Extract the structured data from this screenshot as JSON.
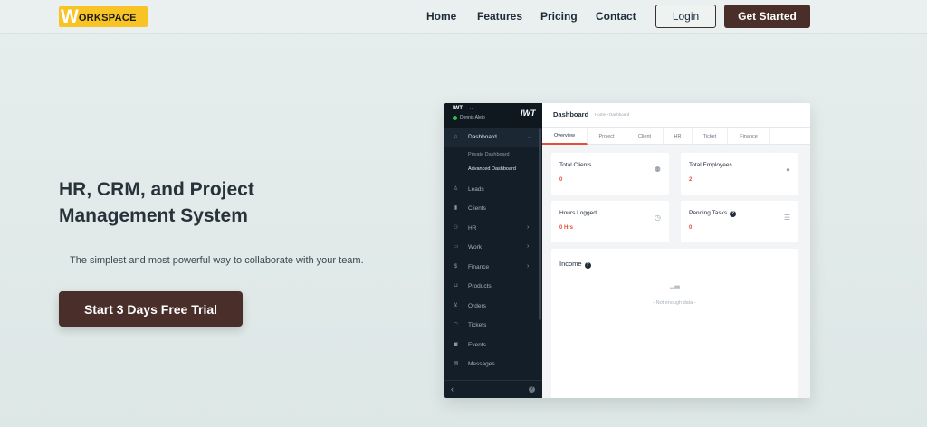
{
  "nav": {
    "logo_w": "W",
    "logo_rest": "ORKSPACE",
    "links": [
      "Home",
      "Features",
      "Pricing",
      "Contact"
    ],
    "login_label": "Login",
    "get_started_label": "Get Started"
  },
  "hero": {
    "title": "HR, CRM, and Project Management System",
    "subtitle": "The simplest and most powerful way to collaborate with your team.",
    "cta_label": "Start 3 Days Free Trial"
  },
  "dashboard": {
    "sidebar": {
      "org": "IWT",
      "user": "Dennis Alejo",
      "logo": "IWT",
      "items": [
        {
          "label": "Dashboard",
          "icon": "home-icon",
          "chevron": "down"
        },
        {
          "label": "Leads",
          "icon": "user-icon",
          "chevron": ""
        },
        {
          "label": "Clients",
          "icon": "bar-chart-icon",
          "chevron": ""
        },
        {
          "label": "HR",
          "icon": "people-icon",
          "chevron": "right"
        },
        {
          "label": "Work",
          "icon": "briefcase-icon",
          "chevron": "right"
        },
        {
          "label": "Finance",
          "icon": "dollar-icon",
          "chevron": "right"
        },
        {
          "label": "Products",
          "icon": "basket-icon",
          "chevron": ""
        },
        {
          "label": "Orders",
          "icon": "cart-icon",
          "chevron": ""
        },
        {
          "label": "Tickets",
          "icon": "headset-icon",
          "chevron": ""
        },
        {
          "label": "Events",
          "icon": "calendar-icon",
          "chevron": ""
        },
        {
          "label": "Messages",
          "icon": "message-icon",
          "chevron": ""
        }
      ],
      "sub_items": [
        "Private Dashboard",
        "Advanced Dashboard"
      ]
    },
    "header": {
      "title": "Dashboard",
      "breadcrumb": "Home • Dashboard"
    },
    "tabs": [
      "Overview",
      "Project",
      "Client",
      "HR",
      "Ticket",
      "Finance"
    ],
    "cards": [
      {
        "title": "Total Clients",
        "value": "0",
        "icon": "users-icon"
      },
      {
        "title": "Total Employees",
        "value": "2",
        "icon": "person-icon"
      },
      {
        "title": "Hours Logged",
        "value": "0 Hrs",
        "icon": "clock-icon"
      },
      {
        "title": "Pending Tasks",
        "value": "0",
        "icon": "list-icon"
      }
    ],
    "income": {
      "title": "Income",
      "empty_text": "- Not enough data -"
    }
  },
  "colors": {
    "brand_dark": "#4a2e2a",
    "logo_yellow": "#f7c325",
    "accent_red": "#e44d3a",
    "sidebar_bg": "#141e28"
  }
}
